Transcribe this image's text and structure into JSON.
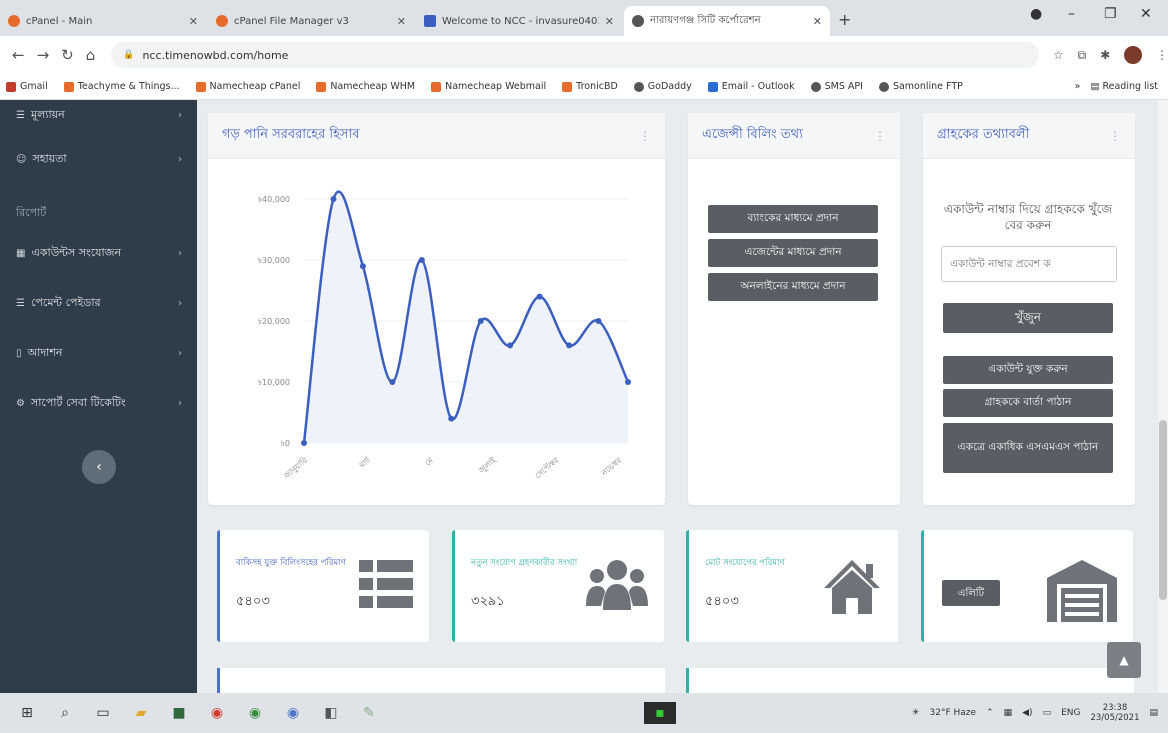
{
  "browser": {
    "tabs": [
      {
        "title": "cPanel - Main",
        "favicon": "cpanel-icon",
        "active": false
      },
      {
        "title": "cPanel File Manager v3",
        "favicon": "cpanel-icon",
        "active": false
      },
      {
        "title": "Welcome to NCC - invasure0401",
        "favicon": "gmail-icon",
        "active": false
      },
      {
        "title": "নারায়ণগঞ্জ সিটি কর্পোরেশন",
        "favicon": "globe-icon",
        "active": true
      }
    ],
    "url": "ncc.timenowbd.com/home",
    "bookmarks": [
      "Gmail",
      "Teachyme & Things...",
      "Namecheap cPanel",
      "Namecheap WHM",
      "Namecheap Webmail",
      "TronicBD",
      "GoDaddy",
      "Email - Outlook",
      "SMS API",
      "Samonline FTP"
    ],
    "reading_list": "Reading list"
  },
  "sidebar": {
    "items": [
      {
        "label": "মূল্যায়ন",
        "top": 10
      },
      {
        "label": "সহায়তা",
        "top": 48
      }
    ],
    "section_head": "রিপোর্ট",
    "items2": [
      {
        "label": "একাউন্টস সংযোজন"
      },
      {
        "label": "পেমেন্ট পেইডার"
      },
      {
        "label": "আদাশন"
      },
      {
        "label": "সাপোর্ট সেবা টিকেটিং"
      }
    ]
  },
  "water_card": {
    "title": "গড় পানি সরবরাহের হিসাব"
  },
  "agency_card": {
    "title": "এজেন্সী বিলিং তথ্য",
    "buttons": [
      "ব্যাংকের মাধ্যমে প্রদান",
      "এজেন্টের মাধ্যমে প্রদান",
      "অনলাইনের মাধ্যমে প্রদান"
    ]
  },
  "customer_card": {
    "title": "গ্রাহকের তথ্যাবলী",
    "instruction": "একাউন্ট নাম্বার দিয়ে গ্রাহককে খুঁজে বের করুন",
    "placeholder": "একাউন্ট নাম্বার প্রবেশ ক",
    "search_btn": "খুঁজুন",
    "add_btn": "একাউন্ট যুক্ত করুন",
    "msg_btn": "গ্রাহককে বার্তা পাঠান",
    "sms_btn": "একত্রে একাধিক এসএমএস পাঠান"
  },
  "stats": [
    {
      "label": "বাকিসহ যুক্ত বিলিংসহের পরিমাণ",
      "value": "৫৪০৩",
      "icon": "table-icon",
      "accent": "#4a73c9"
    },
    {
      "label": "নতুন সংযোগ গ্রহণকারীর সংখ্যা",
      "value": "৩২৯১",
      "icon": "users-icon",
      "accent": "#2ab3a6"
    },
    {
      "label": "মোট সংযোগের পরিমাণ",
      "value": "৫৪০৩",
      "icon": "house-icon",
      "accent": "#2ab3a6"
    },
    {
      "label": "এলিটি",
      "icon": "warehouse-icon",
      "accent": "#2ab3a6"
    }
  ],
  "taskbar": {
    "weather": "32°F Haze",
    "lang": "ENG",
    "time": "23:38",
    "date": "23/05/2021"
  },
  "chart_data": {
    "type": "line",
    "x": [
      "জানুয়ারি",
      "মার্চ",
      "মে",
      "জুলাই",
      "সেপ্টেম্বর",
      "নভেম্বর"
    ],
    "values": [
      0,
      40000,
      29000,
      10000,
      30000,
      4000,
      20000,
      16000,
      24000,
      16000,
      20000,
      10000
    ],
    "y_ticks": [
      "৳0",
      "৳10,000",
      "৳20,000",
      "৳30,000",
      "৳40,000"
    ],
    "ylim": [
      0,
      40000
    ],
    "color": "#3b5fc0",
    "fill": "#eef2fb"
  }
}
